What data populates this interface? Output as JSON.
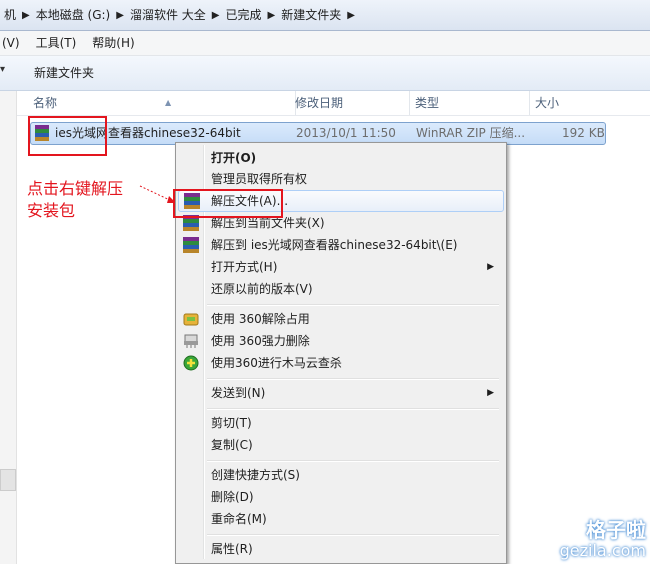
{
  "breadcrumbs": [
    "机",
    "本地磁盘 (G:)",
    "溜溜软件 大全",
    "已完成",
    "新建文件夹"
  ],
  "menubar": [
    "(V)",
    "工具(T)",
    "帮助(H)"
  ],
  "toolbar": {
    "new_folder": "新建文件夹"
  },
  "columns": {
    "name": "名称",
    "modified": "修改日期",
    "type": "类型",
    "size": "大小"
  },
  "file": {
    "name": "ies光域网查看器chinese32-64bit",
    "modified": "2013/10/1 11:50",
    "type": "WinRAR ZIP 压缩...",
    "size": "192 KB"
  },
  "annotation": {
    "line1": "点击右键解压",
    "line2": "安装包"
  },
  "context_menu": {
    "open": "打开(O)",
    "admin": "管理员取得所有权",
    "extract_files": "解压文件(A)...",
    "extract_here": "解压到当前文件夹(X)",
    "extract_to": "解压到 ies光域网查看器chinese32-64bit\\(E)",
    "open_with": "打开方式(H)",
    "restore": "还原以前的版本(V)",
    "unlock360": "使用 360解除占用",
    "delete360": "使用 360强力删除",
    "scan360": "使用360进行木马云查杀",
    "send_to": "发送到(N)",
    "cut": "剪切(T)",
    "copy": "复制(C)",
    "shortcut": "创建快捷方式(S)",
    "delete": "删除(D)",
    "rename": "重命名(M)",
    "properties": "属性(R)"
  },
  "watermark": {
    "line1": "格子啦",
    "line2": "gezila.com"
  },
  "icons": {
    "file": "winrar-archive-icon",
    "chevron": "chevron-right-icon",
    "submenu": "submenu-arrow-icon",
    "unlock": "360-unlock-icon",
    "shred": "360-shred-icon",
    "scan": "360-scan-icon"
  },
  "colors": {
    "annotation": "#e3151e",
    "selection": "#c5dcf7",
    "menu_bg": "#f0f0f0"
  }
}
